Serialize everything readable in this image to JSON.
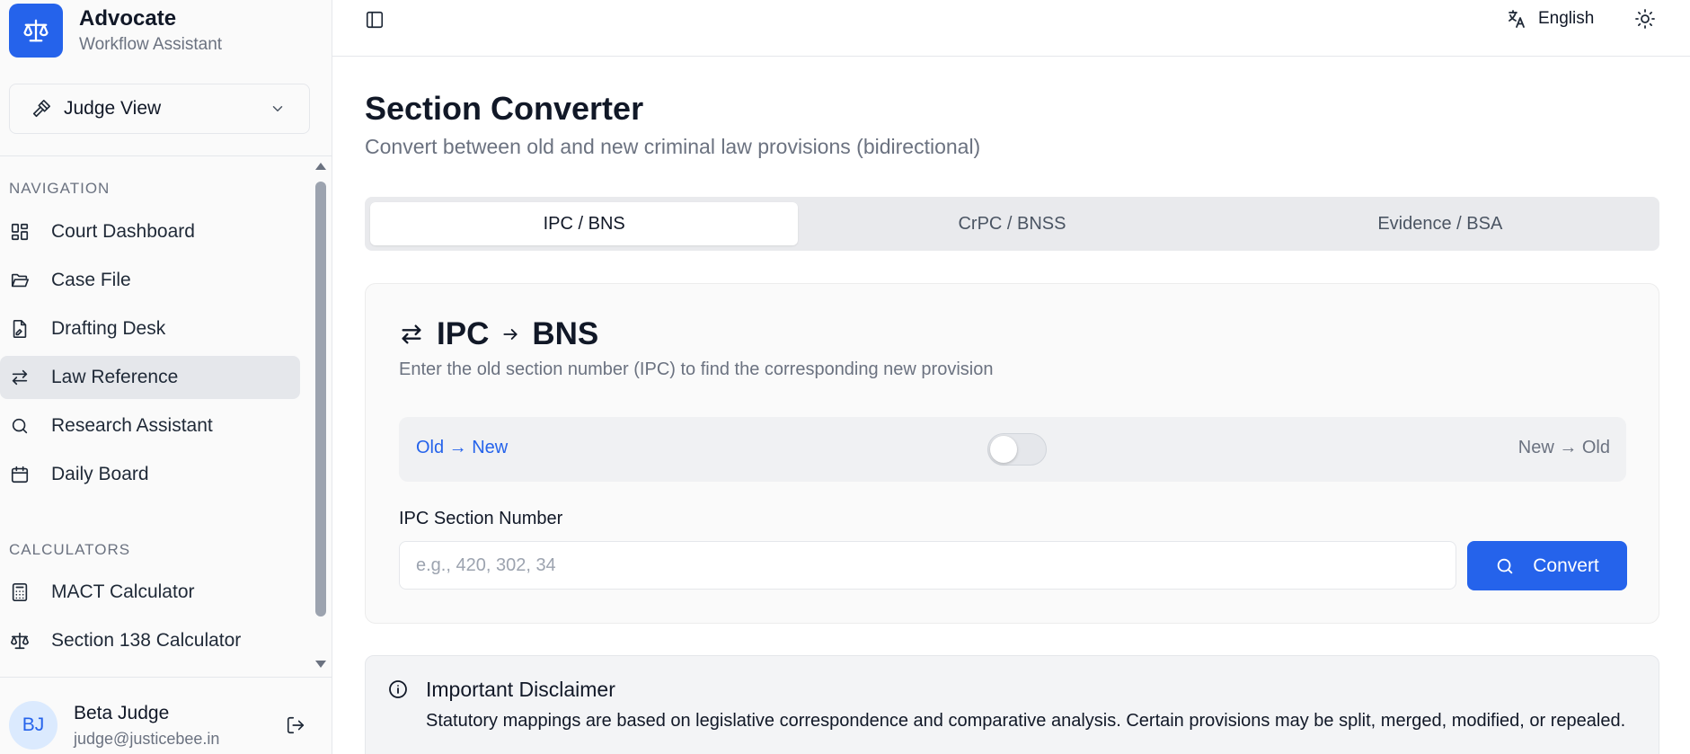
{
  "brand": {
    "title": "Advocate",
    "subtitle": "Workflow Assistant"
  },
  "view_selector": {
    "label": "Judge View"
  },
  "navigation": {
    "heading": "NAVIGATION",
    "items": [
      {
        "label": "Court Dashboard",
        "icon": "dashboard-icon"
      },
      {
        "label": "Case File",
        "icon": "folder-open-icon"
      },
      {
        "label": "Drafting Desk",
        "icon": "file-signature-icon"
      },
      {
        "label": "Law Reference",
        "icon": "arrows-swap-icon",
        "active": true
      },
      {
        "label": "Research Assistant",
        "icon": "search-icon"
      },
      {
        "label": "Daily Board",
        "icon": "calendar-icon"
      }
    ]
  },
  "calculators": {
    "heading": "CALCULATORS",
    "items": [
      {
        "label": "MACT Calculator",
        "icon": "calculator-icon"
      },
      {
        "label": "Section 138 Calculator",
        "icon": "scale-icon"
      }
    ]
  },
  "user": {
    "initials": "BJ",
    "name": "Beta Judge",
    "email": "judge@justicebee.in"
  },
  "topbar": {
    "language": "English"
  },
  "page": {
    "title": "Section Converter",
    "subtitle": "Convert between old and new criminal law provisions (bidirectional)"
  },
  "tabs": [
    {
      "label": "IPC / BNS",
      "active": true
    },
    {
      "label": "CrPC / BNSS"
    },
    {
      "label": "Evidence / BSA"
    }
  ],
  "converter": {
    "from": "IPC",
    "to": "BNS",
    "description": "Enter the old section number (IPC) to find the corresponding new provision",
    "direction_old_new": "Old → New",
    "direction_new_old": "New → Old",
    "toggle_on": false,
    "field_label": "IPC Section Number",
    "field_placeholder": "e.g., 420, 302, 34",
    "field_value": "",
    "button_label": "Convert"
  },
  "disclaimer": {
    "title": "Important Disclaimer",
    "body": "Statutory mappings are based on legislative correspondence and comparative analysis. Certain provisions may be split, merged, modified, or repealed."
  },
  "colors": {
    "accent": "#2563eb",
    "muted_text": "#6b7280",
    "active_nav_bg": "#e5e7eb"
  }
}
